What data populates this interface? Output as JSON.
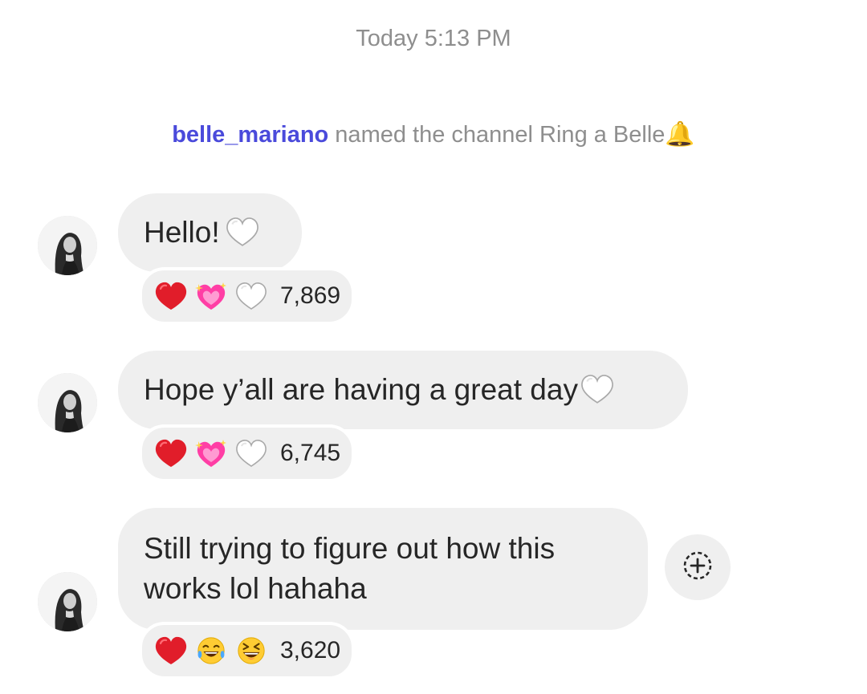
{
  "header": {
    "timestamp": "Today 5:13 PM"
  },
  "system_message": {
    "username": "belle_mariano",
    "text": " named the channel Ring a Belle",
    "emoji_icon": "bell-icon"
  },
  "messages": [
    {
      "text": "Hello!",
      "trailing_icon": "white-heart-icon",
      "reactions": {
        "icons": [
          "red-heart-icon",
          "sparkling-pink-heart-icon",
          "white-heart-icon"
        ],
        "count": "7,869"
      }
    },
    {
      "text": "Hope y’all are having a great day",
      "trailing_icon": "white-heart-icon",
      "reactions": {
        "icons": [
          "red-heart-icon",
          "sparkling-pink-heart-icon",
          "white-heart-icon"
        ],
        "count": "6,745"
      }
    },
    {
      "text_line1": "Still trying to figure out how this",
      "text_line2": "works lol hahaha",
      "reactions": {
        "icons": [
          "red-heart-icon",
          "tears-of-joy-icon",
          "squinting-laugh-icon"
        ],
        "count": "3,620"
      }
    }
  ],
  "colors": {
    "username": "#4a4adb",
    "bubble": "#efefef",
    "meta_text": "#8e8e8e"
  }
}
